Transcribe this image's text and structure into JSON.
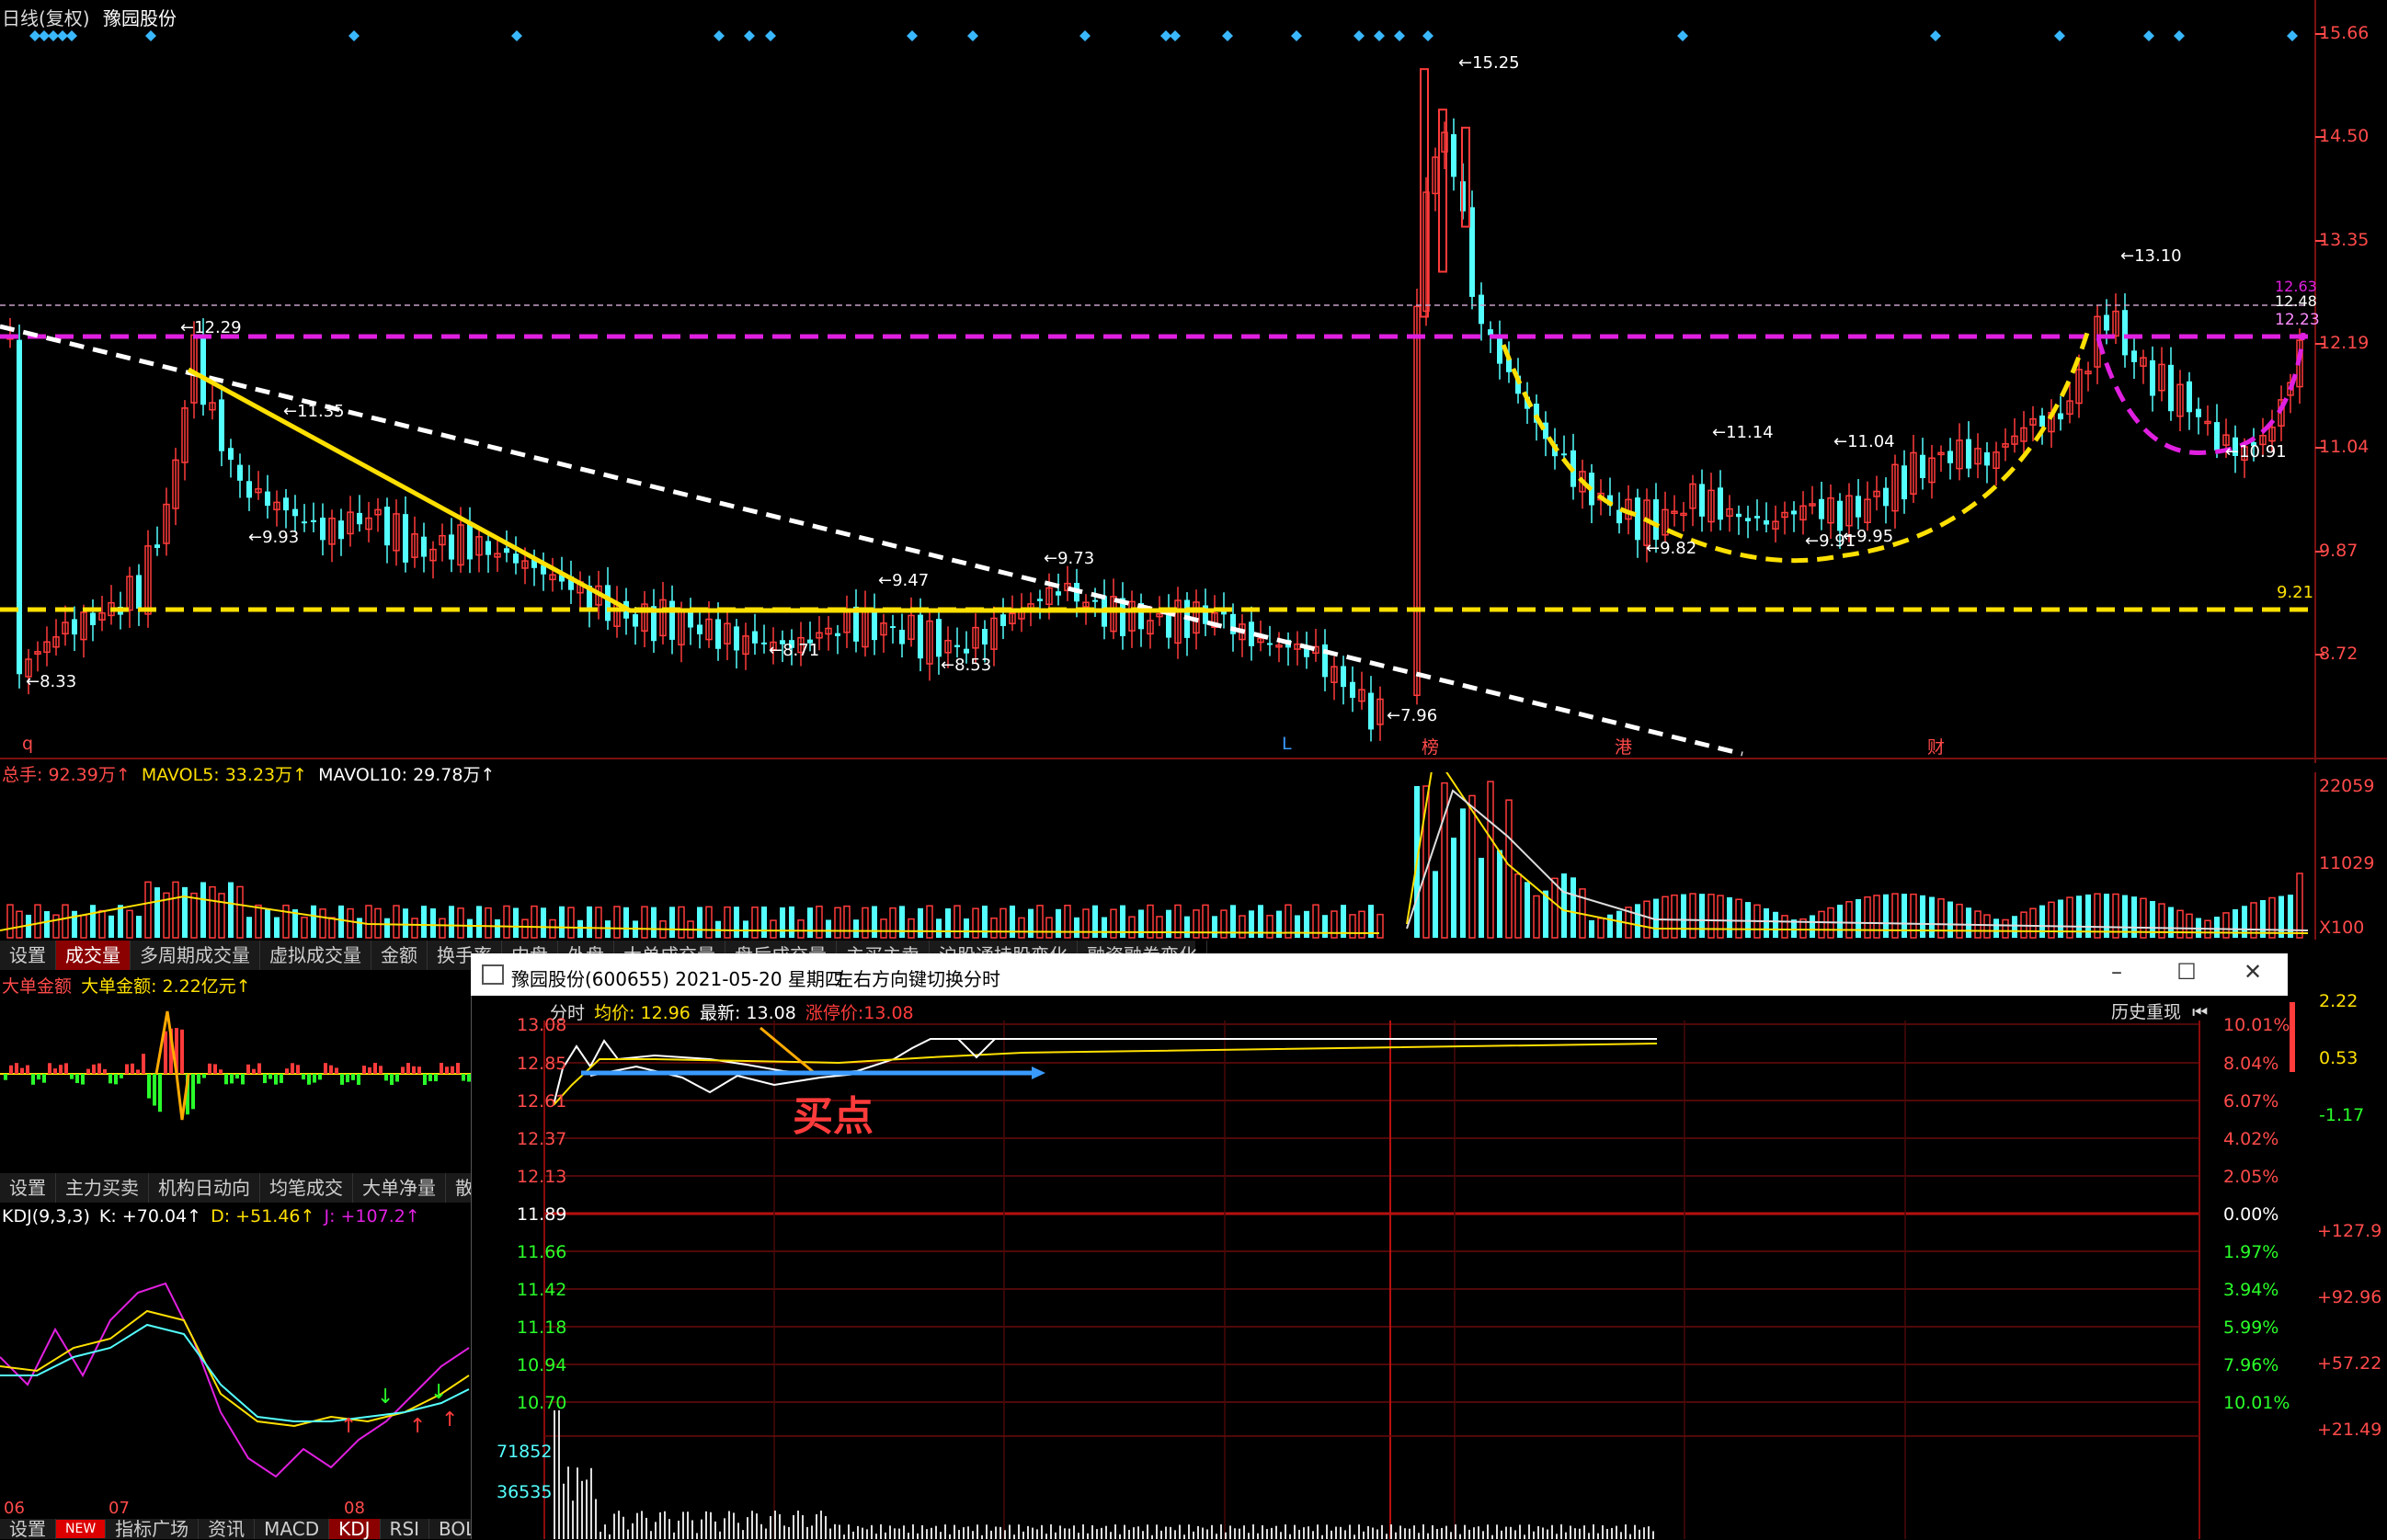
{
  "main": {
    "title_period": "日线(复权)",
    "title_stock": "豫园股份",
    "price_axis": [
      "15.66",
      "14.50",
      "13.35",
      "12.19",
      "11.04",
      "9.87",
      "8.72"
    ],
    "line_levels": {
      "purple": "12.23",
      "yellow": "9.21"
    },
    "right_tags": [
      "12.63",
      "12.48",
      "12.23"
    ],
    "price_labels": [
      "15.25",
      "13.10",
      "12.29",
      "11.35",
      "9.93",
      "11.14",
      "11.04",
      "9.82",
      "9.91",
      "9.95",
      "10.91",
      "9.47",
      "9.73",
      "8.71",
      "8.53",
      "8.33",
      "7.96"
    ],
    "bottom_markers": [
      "q",
      "L",
      "榜",
      "港",
      "财"
    ]
  },
  "volume": {
    "header": {
      "label": "总手: 92.39万↑",
      "mavol5": "MAVOL5: 33.23万↑",
      "mavol10": "MAVOL10: 29.78万↑"
    },
    "axis": [
      "22059",
      "11029",
      "X100"
    ]
  },
  "tabs1": [
    "设置",
    "成交量",
    "多周期成交量",
    "虚拟成交量",
    "金额",
    "换手率",
    "内盘",
    "外盘",
    "大单成交量",
    "盘后成交量",
    "主买主卖",
    "沪股通持股变化",
    "融资融券变化"
  ],
  "big_order": {
    "label": "大单金额",
    "value": "大单金额: 2.22亿元↑"
  },
  "tabs2": [
    "设置",
    "主力买卖",
    "机构日动向",
    "均笔成交",
    "大单净量",
    "散户"
  ],
  "kdj": {
    "label": "KDJ(9,3,3)",
    "k": "K: +70.04↑",
    "d": "D: +51.46↑",
    "j": "J: +107.2↑",
    "x_labels": [
      "06",
      "07",
      "08"
    ],
    "right_axis": [
      "+127.9",
      "+92.96",
      "+57.22",
      "+21.49"
    ]
  },
  "right_ind_axis": [
    "2.22",
    "0.53",
    "-1.17"
  ],
  "tabs3": [
    "设置",
    "NEW",
    "指标广场",
    "资讯",
    "MACD",
    "KDJ",
    "RSI",
    "BOLL"
  ],
  "popup": {
    "title": "豫园股份(600655) 2021-05-20 星期四",
    "hint": "左右方向键切换分时",
    "info": {
      "mode": "分时",
      "avg": "均价: 12.96",
      "last": "最新: 13.08",
      "limit": "涨停价:13.08"
    },
    "history_button": "历史重现",
    "buy_label": "买点",
    "price_axis": [
      "13.08",
      "12.85",
      "12.61",
      "12.37",
      "12.13",
      "11.89",
      "11.66",
      "11.42",
      "11.18",
      "10.94",
      "10.70"
    ],
    "pct_axis": [
      "10.01%",
      "8.04%",
      "6.07%",
      "4.02%",
      "2.05%",
      "0.00%",
      "1.97%",
      "3.94%",
      "5.99%",
      "7.96%",
      "10.01%"
    ],
    "vol_axis": [
      "71852",
      "36535"
    ]
  },
  "colors": {
    "up": "#ff3b3b",
    "down": "#54ffff",
    "purple": "#e020e0",
    "yellow": "#ffe000",
    "white": "#ffffff"
  }
}
